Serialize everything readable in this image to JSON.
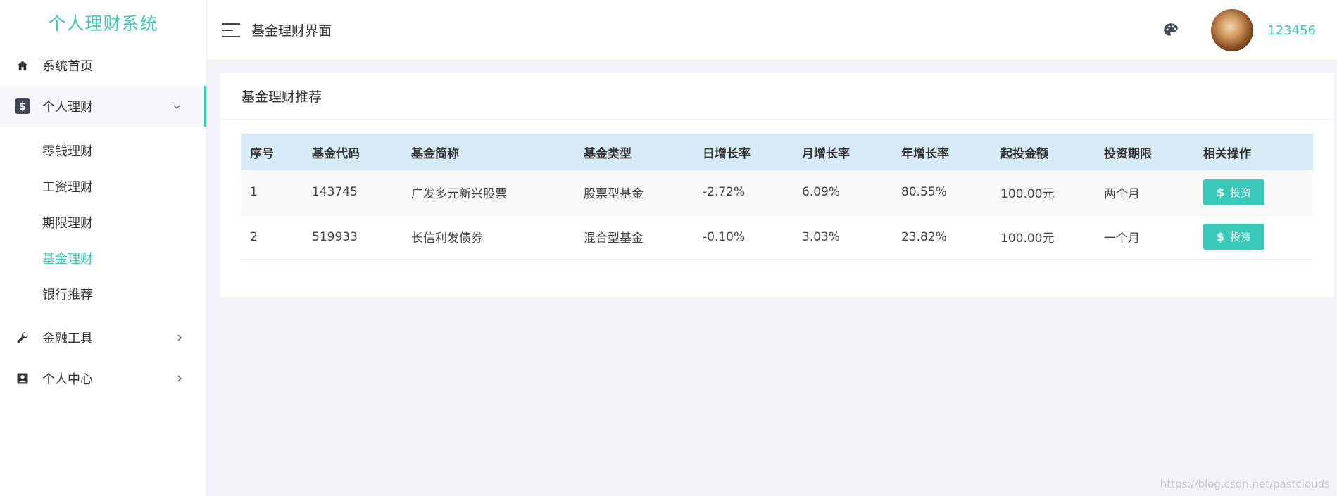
{
  "brand": "个人理财系统",
  "sidebar": {
    "home": "系统首页",
    "personal_finance": {
      "label": "个人理财",
      "items": [
        "零钱理财",
        "工资理财",
        "期限理财",
        "基金理财",
        "银行推荐"
      ],
      "active": "基金理财"
    },
    "tools": "金融工具",
    "center": "个人中心"
  },
  "header": {
    "title": "基金理财界面",
    "username": "123456"
  },
  "card": {
    "title": "基金理财推荐",
    "columns": [
      "序号",
      "基金代码",
      "基金简称",
      "基金类型",
      "日增长率",
      "月增长率",
      "年增长率",
      "起投金额",
      "投资期限",
      "相关操作"
    ],
    "rows": [
      {
        "no": "1",
        "code": "143745",
        "name": "广发多元新兴股票",
        "type": "股票型基金",
        "daily": "-2.72%",
        "monthly": "6.09%",
        "yearly": "80.55%",
        "min": "100.00元",
        "term": "两个月",
        "action": "投资"
      },
      {
        "no": "2",
        "code": "519933",
        "name": "长信利发债券",
        "type": "混合型基金",
        "daily": "-0.10%",
        "monthly": "3.03%",
        "yearly": "23.82%",
        "min": "100.00元",
        "term": "一个月",
        "action": "投资"
      }
    ]
  },
  "watermark": "https://blog.csdn.net/pastclouds",
  "colors": {
    "accent": "#3ec8b8",
    "table_header": "#d7ebf7",
    "button": "#38c9b9"
  }
}
